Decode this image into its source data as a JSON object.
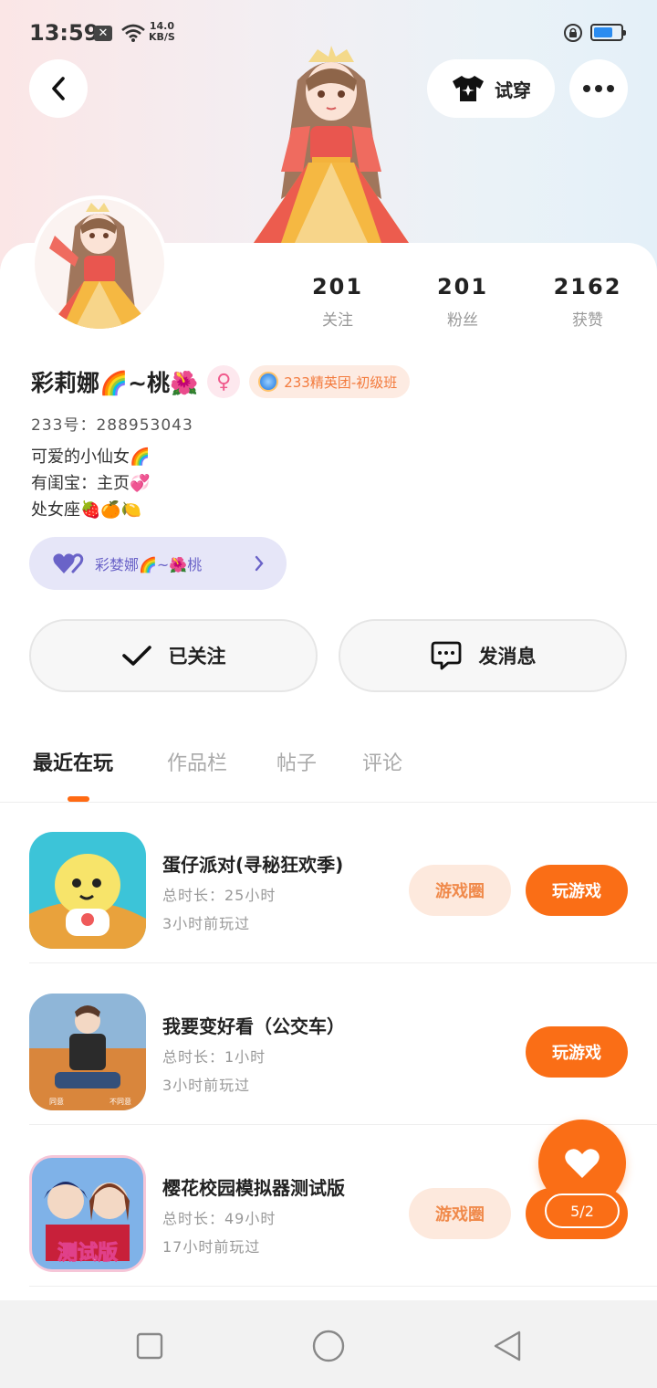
{
  "status_bar": {
    "time": "13:59",
    "net_speed_value": "14.0",
    "net_speed_unit": "KB/S"
  },
  "header": {
    "try_on_label": "试穿"
  },
  "stats": [
    {
      "value": "201",
      "label": "关注"
    },
    {
      "value": "201",
      "label": "粉丝"
    },
    {
      "value": "2162",
      "label": "获赞"
    }
  ],
  "profile": {
    "name": "彩莉娜🌈~桃🌺",
    "gender_symbol": "♀",
    "team_badge": "233精英团-初级班",
    "uid": "233号：288953043",
    "bio": [
      "可爱的小仙女🌈",
      "有闺宝：主页💞",
      "处女座🍓🍊🍋"
    ],
    "cp_name": "彩婪娜🌈~🌺桃"
  },
  "actions": {
    "follow_label": "已关注",
    "message_label": "发消息"
  },
  "tabs": [
    "最近在玩",
    "作品栏",
    "帖子",
    "评论"
  ],
  "games": [
    {
      "title": "蛋仔派对(寻秘狂欢季)",
      "total_time": "总时长：25小时",
      "last_played": "3小时前玩过",
      "circle_label": "游戏圈",
      "play_label": "玩游戏"
    },
    {
      "title": "我要变好看（公交车）",
      "total_time": "总时长：1小时",
      "last_played": "3小时前玩过",
      "circle_label": "",
      "play_label": "玩游戏",
      "icon_tags": [
        "同意",
        "不同意"
      ]
    },
    {
      "title": "樱花校园模拟器测试版",
      "total_time": "总时长：49小时",
      "last_played": "17小时前玩过",
      "circle_label": "游戏圈",
      "play_label": "玩游戏",
      "icon_tag": "测试版"
    }
  ],
  "fab": {
    "page_indicator": "5/2"
  },
  "colors": {
    "accent": "#fa6e16",
    "accent_light": "#fde9dd",
    "chip_bg": "#e6e6f8",
    "chip_text": "#6a63c8"
  }
}
